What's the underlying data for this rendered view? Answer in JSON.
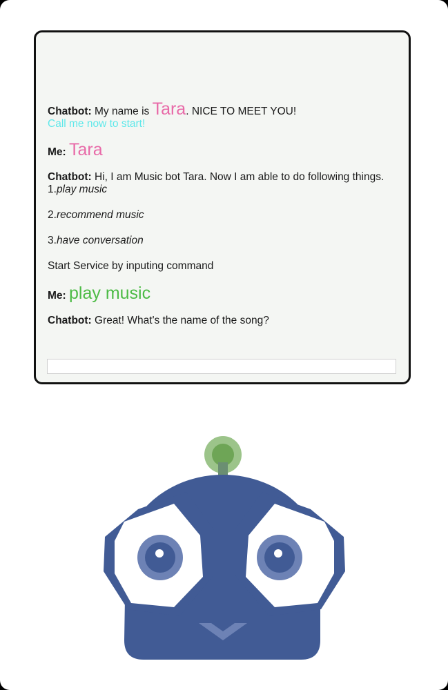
{
  "chat": {
    "messages": [
      {
        "speaker": "Chatbot:",
        "pre": "My name is",
        "name": "Tara",
        "post": ". NICE TO MEET YOU!",
        "cta": "Call me now to start!"
      },
      {
        "speaker": "Me:",
        "text": "Tara"
      },
      {
        "speaker": "Chatbot:",
        "intro": "Hi, I am Music bot Tara. Now I am able to do following things.",
        "options": [
          {
            "num": "1.",
            "label": "play music"
          },
          {
            "num": "2.",
            "label": "recommend music"
          },
          {
            "num": "3.",
            "label": "have conversation"
          }
        ],
        "outro": "Start Service by inputing command"
      },
      {
        "speaker": "Me:",
        "text": "play music"
      },
      {
        "speaker": "Chatbot:",
        "text": "Great! What's the name of the song?"
      }
    ],
    "input": {
      "value": "",
      "placeholder": ""
    }
  },
  "colors": {
    "name_pink": "#e86aa8",
    "cta_cyan": "#5ee8ea",
    "command_green": "#4cbb45",
    "robot_blue": "#415b95",
    "robot_eye_ring": "#6d82b5",
    "antenna_green": "#7db05f"
  },
  "mascot": {
    "icon": "robot-mascot-icon"
  }
}
